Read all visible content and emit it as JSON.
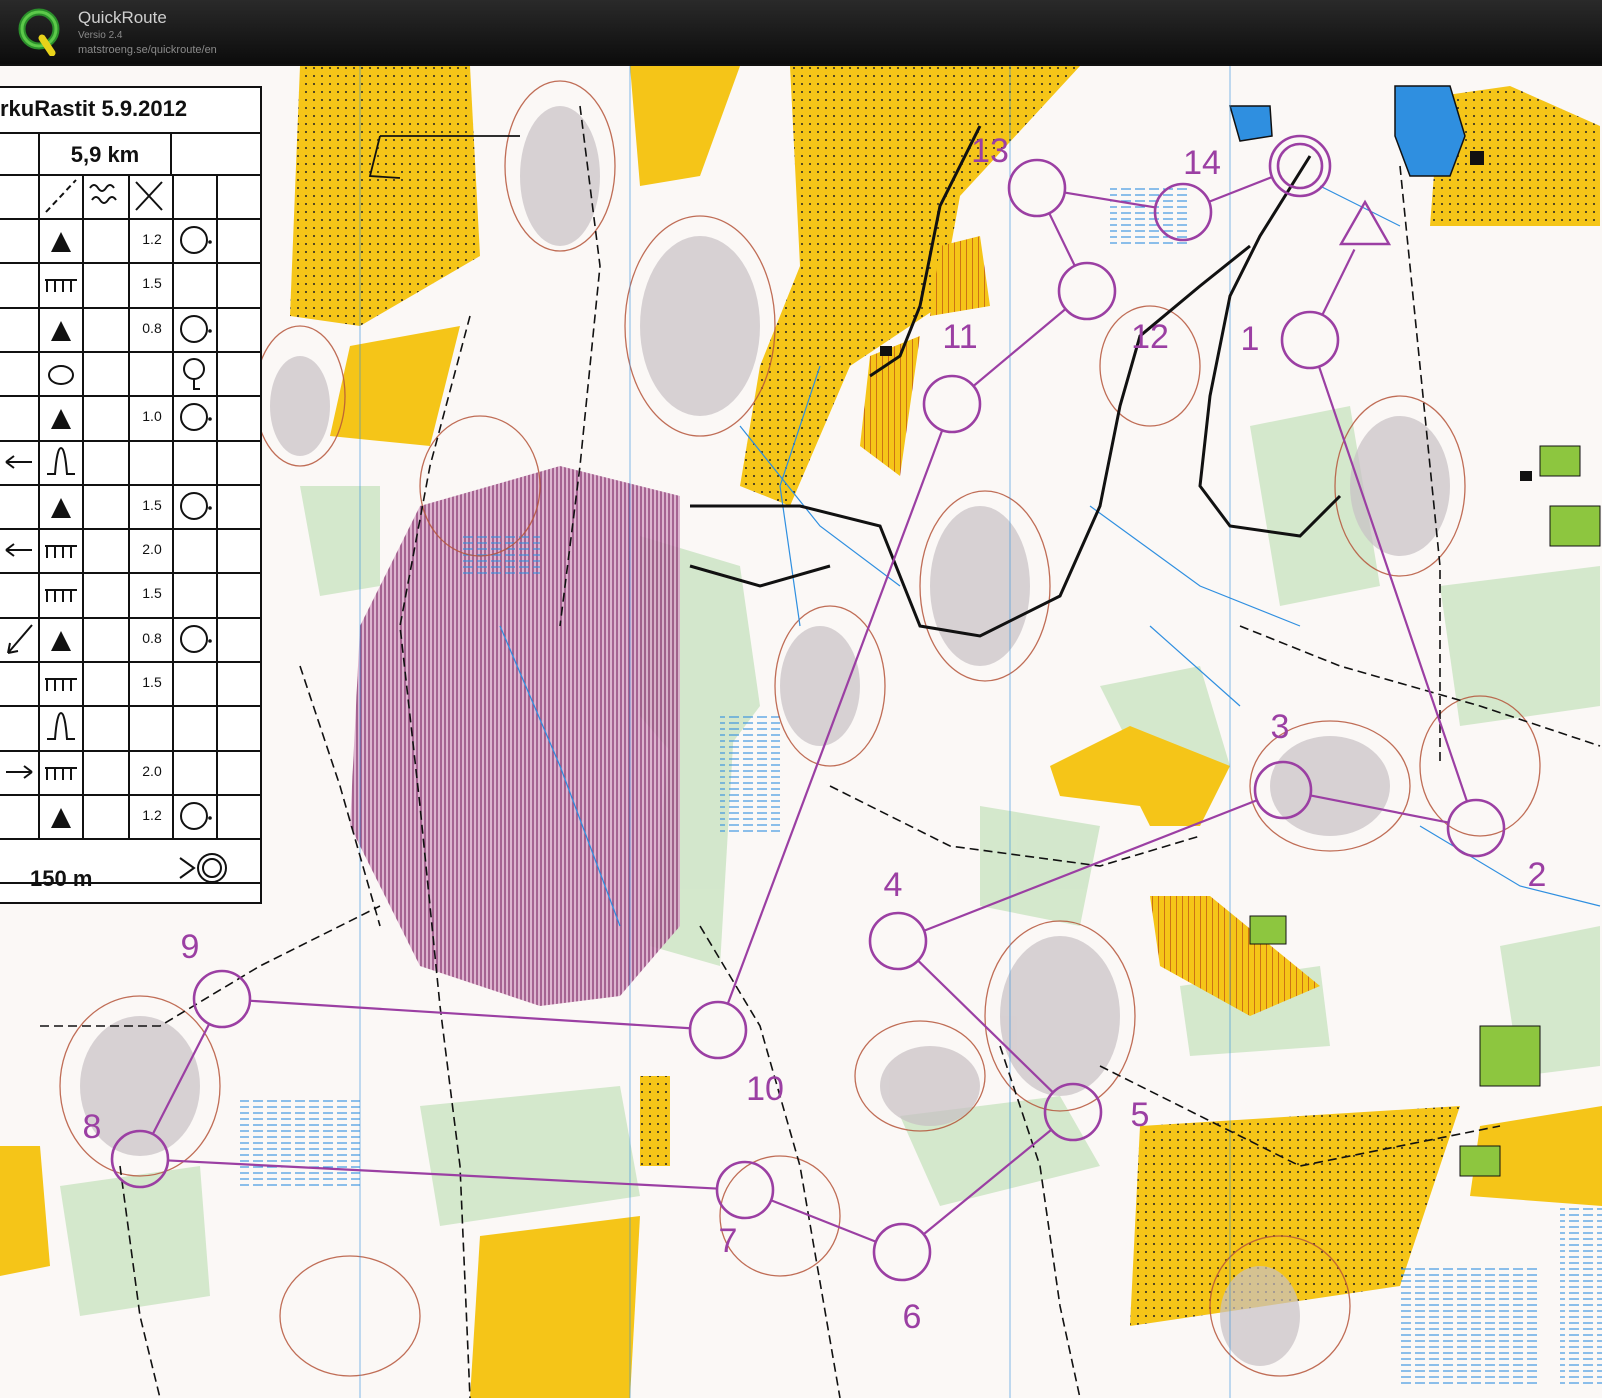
{
  "app": {
    "title": "QuickRoute",
    "version": "Versio 2.4",
    "url": "matstroeng.se/quickroute/en"
  },
  "description_sheet": {
    "title": "rkuRastit 5.9.2012",
    "length": "5,9 km",
    "footer": "150 m",
    "rows": [
      {
        "dist": "1.2"
      },
      {
        "dist": "1.5"
      },
      {
        "dist": "0.8"
      },
      {
        "dist": ""
      },
      {
        "dist": "1.0"
      },
      {
        "dist": ""
      },
      {
        "dist": "1.5"
      },
      {
        "dist": "2.0"
      },
      {
        "dist": "1.5"
      },
      {
        "dist": "0.8"
      },
      {
        "dist": "1.5"
      },
      {
        "dist": ""
      },
      {
        "dist": "2.0"
      },
      {
        "dist": "1.2"
      }
    ]
  },
  "course": {
    "color": "#9b3fa3",
    "controls": [
      {
        "label": "1"
      },
      {
        "label": "2"
      },
      {
        "label": "3"
      },
      {
        "label": "4"
      },
      {
        "label": "5"
      },
      {
        "label": "6"
      },
      {
        "label": "7"
      },
      {
        "label": "8"
      },
      {
        "label": "9"
      },
      {
        "label": "10"
      },
      {
        "label": "11"
      },
      {
        "label": "12"
      },
      {
        "label": "13"
      },
      {
        "label": "14"
      }
    ]
  },
  "colors": {
    "open_land": "#f5c518",
    "forest": "#ffffff",
    "green_vegetation": "#cfe6c8",
    "water": "#2f8fe0",
    "contour": "#b5553a"
  }
}
